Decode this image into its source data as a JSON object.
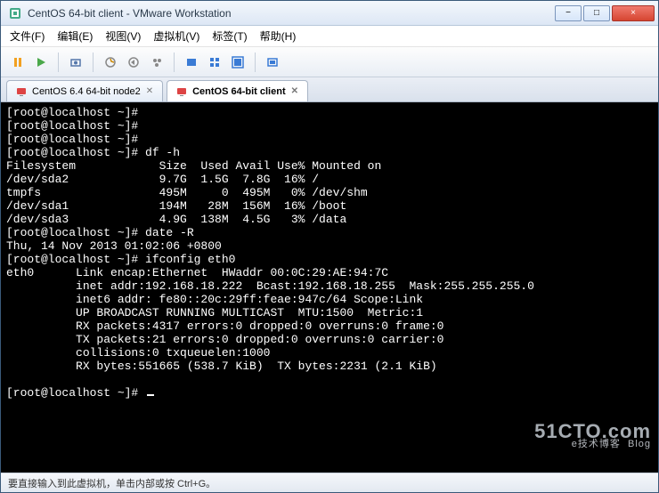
{
  "window": {
    "title": "CentOS 64-bit client - VMware Workstation"
  },
  "menus": {
    "file": "文件(F)",
    "edit": "编辑(E)",
    "view": "视图(V)",
    "vm": "虚拟机(V)",
    "tabs": "标签(T)",
    "help": "帮助(H)"
  },
  "tabs": {
    "items": [
      {
        "label": "CentOS 6.4 64-bit node2",
        "active": false
      },
      {
        "label": "CentOS 64-bit client",
        "active": true
      }
    ]
  },
  "terminal": {
    "prompt": "[root@localhost ~]# ",
    "cmd_df": "df -h",
    "df_header": "Filesystem            Size  Used Avail Use% Mounted on",
    "df_rows": [
      "/dev/sda2             9.7G  1.5G  7.8G  16% /",
      "tmpfs                 495M     0  495M   0% /dev/shm",
      "/dev/sda1             194M   28M  156M  16% /boot",
      "/dev/sda3             4.9G  138M  4.5G   3% /data"
    ],
    "cmd_date": "date -R",
    "date_out": "Thu, 14 Nov 2013 01:02:06 +0800",
    "cmd_ifcfg": "ifconfig eth0",
    "ifcfg_out": [
      "eth0      Link encap:Ethernet  HWaddr 00:0C:29:AE:94:7C",
      "          inet addr:192.168.18.222  Bcast:192.168.18.255  Mask:255.255.255.0",
      "          inet6 addr: fe80::20c:29ff:feae:947c/64 Scope:Link",
      "          UP BROADCAST RUNNING MULTICAST  MTU:1500  Metric:1",
      "          RX packets:4317 errors:0 dropped:0 overruns:0 frame:0",
      "          TX packets:21 errors:0 dropped:0 overruns:0 carrier:0",
      "          collisions:0 txqueuelen:1000",
      "          RX bytes:551665 (538.7 KiB)  TX bytes:2231 (2.1 KiB)"
    ]
  },
  "statusbar": {
    "text": "要直接输入到此虚拟机，单击内部或按 Ctrl+G。"
  },
  "watermark": {
    "main": "51CTO.com",
    "sub": "e技术博客  Blog"
  },
  "icons": {
    "app": "vmware-icon",
    "min": "−",
    "max": "□",
    "close": "×"
  }
}
